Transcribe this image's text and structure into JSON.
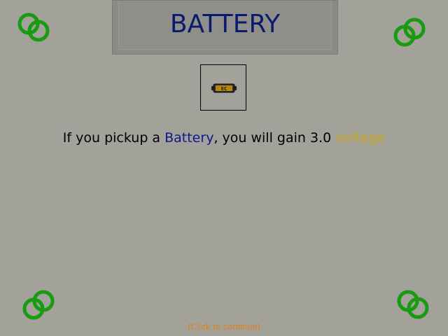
{
  "title": "BATTERY",
  "item": {
    "icon": "battery-icon",
    "icon_label": "EC"
  },
  "message": {
    "prefix": "If you pickup a ",
    "item_name": "Battery",
    "middle": ", you will gain 3.0 ",
    "stat_name": "voltage"
  },
  "continue_hint": "(Click to continue)",
  "decorations": {
    "corner_icon": "chain-link-icon",
    "chain_color": "#1a9a10"
  },
  "colors": {
    "background": "#a2a29a",
    "title": "#0c1a6e",
    "item_highlight": "#0c1a8a",
    "stat_highlight": "#c8a418",
    "continue_text": "#e0821c"
  }
}
